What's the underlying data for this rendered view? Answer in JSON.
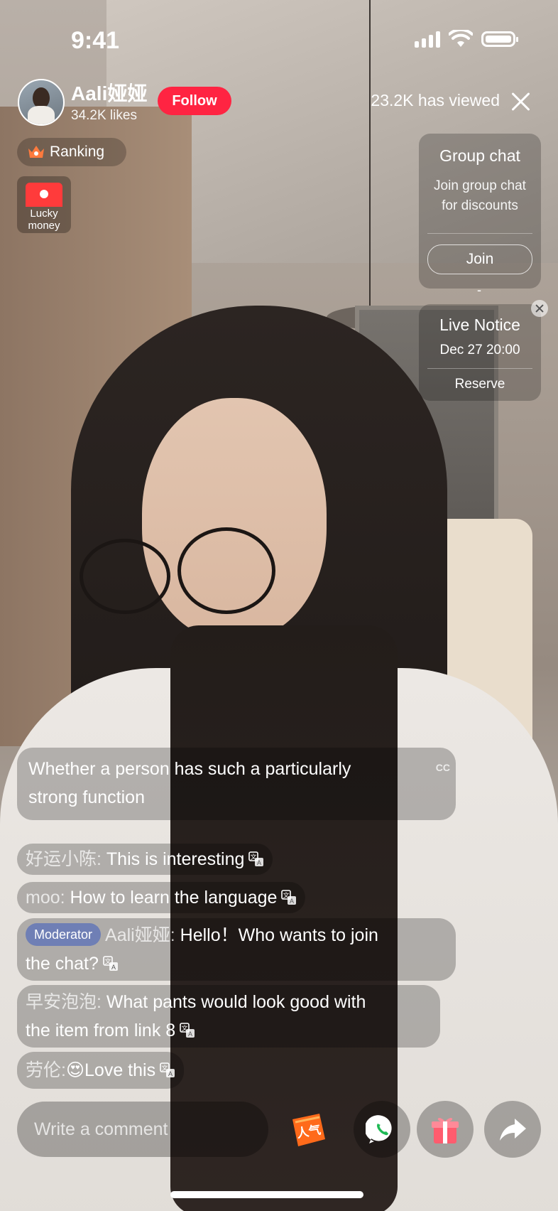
{
  "status_bar": {
    "time": "9:41"
  },
  "host": {
    "name": "Aali娅娅",
    "likes": "34.2K likes",
    "follow_label": "Follow",
    "viewed": "23.2K has viewed"
  },
  "badges": {
    "ranking_label": "Ranking",
    "lucky_line1": "Lucky",
    "lucky_line2": "money"
  },
  "group_chat": {
    "title": "Group chat",
    "description_line1": "Join group chat",
    "description_line2": "for discounts",
    "join_label": "Join",
    "dash": "-"
  },
  "live_notice": {
    "title": "Live Notice",
    "time": "Dec 27 20:00",
    "reserve_label": "Reserve"
  },
  "caption": {
    "text_line1": "Whether a person has such a particularly",
    "text_line2": "strong function",
    "cc_label": "CC"
  },
  "chat": [
    {
      "nick": "好运小陈:",
      "text": " This is interesting"
    },
    {
      "nick": "moo:",
      "text": " How to learn the language"
    },
    {
      "badge": "Moderator",
      "nick": "Aali娅娅:",
      "text_line1": " Hello！Who wants to join",
      "text_line2": "the chat?"
    },
    {
      "nick": "早安泡泡:",
      "text_line1": " What pants would look good with",
      "text_line2": "the item from link 8"
    },
    {
      "nick": "劳伦:",
      "emoji": "😍",
      "text": "Love this"
    }
  ],
  "bottom_bar": {
    "comment_placeholder": "Write a comment",
    "popular_icon_text": "人气"
  },
  "colors": {
    "accent_red": "#ff2442",
    "moderator_badge": "#6f7fb5"
  },
  "icons": [
    "crown-icon",
    "red-envelope-icon",
    "close-icon",
    "translate-icon",
    "popular-icon",
    "phone-icon",
    "gift-icon",
    "share-icon"
  ]
}
